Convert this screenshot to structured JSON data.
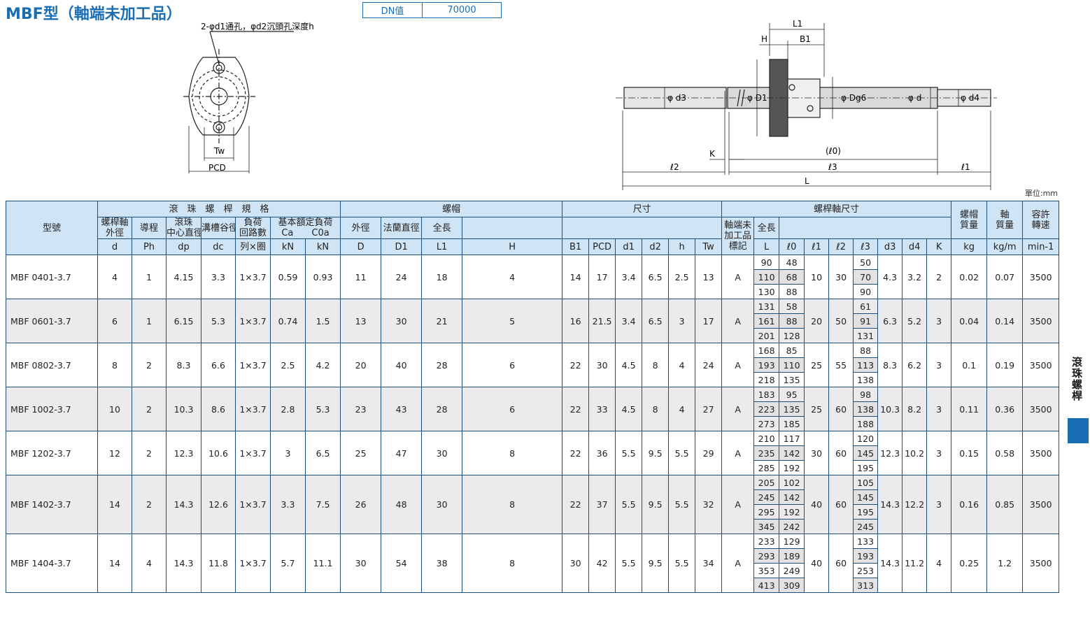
{
  "header": {
    "title": "MBF型（軸端未加工品）",
    "dn_label": "DN值",
    "dn_value": "70000",
    "unit": "單位:mm"
  },
  "drawing": {
    "left_note": "2-φd1通孔，φd2沉頭孔深度h",
    "tw": "Tw",
    "pcd": "PCD",
    "L1": "L1",
    "H": "H",
    "B1": "B1",
    "d3": "φ d3",
    "D1": "φ D1",
    "Dg6": "φ Dg6",
    "d": "φ d",
    "d4": "φ d4",
    "K": "K",
    "l0": "(ℓ0)",
    "l2": "ℓ2",
    "l3": "ℓ3",
    "l1": "ℓ1",
    "L": "L"
  },
  "table_head": {
    "model": "型號",
    "ball_spec": "滾　珠　螺　桿　規　格",
    "nut": "螺帽",
    "nut_dim": "尺寸",
    "shaft_dim": "螺桿軸尺寸",
    "nut_mass_1": "螺帽",
    "nut_mass_2": "質量",
    "shaft_mass_1": "軸",
    "shaft_mass_2": "質量",
    "speed_1": "容許",
    "speed_2": "轉速",
    "od_1": "螺桿軸",
    "od_2": "外徑",
    "lead": "導程",
    "bcd_1": "滾珠",
    "bcd_2": "中心直徑",
    "groove": "溝槽谷徑",
    "circ_1": "負荷",
    "circ_2": "回路數",
    "rating": "基本額定負荷",
    "nut_D": "外徑",
    "flange": "法蘭直徑",
    "nut_len": "全長",
    "shaft_code": "軸端未加工品標記",
    "shaft_len": "全長",
    "ca": "Ca",
    "c0a": "C0a",
    "sym": [
      "d",
      "Ph",
      "dp",
      "dc",
      "列×圈",
      "kN",
      "kN",
      "D",
      "D1",
      "L1",
      "H",
      "B1",
      "PCD",
      "d1",
      "d2",
      "h",
      "Tw",
      "L",
      "ℓ0",
      "ℓ1",
      "ℓ2",
      "ℓ3",
      "d3",
      "d4",
      "K",
      "kg",
      "kg/m",
      "min-1"
    ]
  },
  "rows": [
    {
      "model": "MBF 0401-3.7",
      "d": "4",
      "ph": "1",
      "dp": "4.15",
      "dc": "3.3",
      "circ": "1×3.7",
      "ca": "0.59",
      "c0a": "0.93",
      "D": "11",
      "D1": "24",
      "L1": "18",
      "H": "4",
      "B1": "14",
      "PCD": "17",
      "d1": "3.4",
      "d2": "6.5",
      "h": "2.5",
      "Tw": "13",
      "code": "A",
      "L": [
        "90",
        "110",
        "130"
      ],
      "l0": [
        "48",
        "68",
        "88"
      ],
      "l1": "10",
      "l2": "30",
      "l3": [
        "50",
        "70",
        "90"
      ],
      "d3": "4.3",
      "d4": "3.2",
      "K": "2",
      "nut_mass": "0.02",
      "shaft_mass": "0.07",
      "speed": "3500"
    },
    {
      "model": "MBF 0601-3.7",
      "d": "6",
      "ph": "1",
      "dp": "6.15",
      "dc": "5.3",
      "circ": "1×3.7",
      "ca": "0.74",
      "c0a": "1.5",
      "D": "13",
      "D1": "30",
      "L1": "21",
      "H": "5",
      "B1": "16",
      "PCD": "21.5",
      "d1": "3.4",
      "d2": "6.5",
      "h": "3",
      "Tw": "17",
      "code": "A",
      "L": [
        "131",
        "161",
        "201"
      ],
      "l0": [
        "58",
        "88",
        "128"
      ],
      "l1": "20",
      "l2": "50",
      "l3": [
        "61",
        "91",
        "131"
      ],
      "d3": "6.3",
      "d4": "5.2",
      "K": "3",
      "nut_mass": "0.04",
      "shaft_mass": "0.14",
      "speed": "3500"
    },
    {
      "model": "MBF 0802-3.7",
      "d": "8",
      "ph": "2",
      "dp": "8.3",
      "dc": "6.6",
      "circ": "1×3.7",
      "ca": "2.5",
      "c0a": "4.2",
      "D": "20",
      "D1": "40",
      "L1": "28",
      "H": "6",
      "B1": "22",
      "PCD": "30",
      "d1": "4.5",
      "d2": "8",
      "h": "4",
      "Tw": "24",
      "code": "A",
      "L": [
        "168",
        "193",
        "218"
      ],
      "l0": [
        "85",
        "110",
        "135"
      ],
      "l1": "25",
      "l2": "55",
      "l3": [
        "88",
        "113",
        "138"
      ],
      "d3": "8.3",
      "d4": "6.2",
      "K": "3",
      "nut_mass": "0.1",
      "shaft_mass": "0.19",
      "speed": "3500"
    },
    {
      "model": "MBF 1002-3.7",
      "d": "10",
      "ph": "2",
      "dp": "10.3",
      "dc": "8.6",
      "circ": "1×3.7",
      "ca": "2.8",
      "c0a": "5.3",
      "D": "23",
      "D1": "43",
      "L1": "28",
      "H": "6",
      "B1": "22",
      "PCD": "33",
      "d1": "4.5",
      "d2": "8",
      "h": "4",
      "Tw": "27",
      "code": "A",
      "L": [
        "183",
        "223",
        "273"
      ],
      "l0": [
        "95",
        "135",
        "185"
      ],
      "l1": "25",
      "l2": "60",
      "l3": [
        "98",
        "138",
        "188"
      ],
      "d3": "10.3",
      "d4": "8.2",
      "K": "3",
      "nut_mass": "0.11",
      "shaft_mass": "0.36",
      "speed": "3500"
    },
    {
      "model": "MBF 1202-3.7",
      "d": "12",
      "ph": "2",
      "dp": "12.3",
      "dc": "10.6",
      "circ": "1×3.7",
      "ca": "3",
      "c0a": "6.5",
      "D": "25",
      "D1": "47",
      "L1": "30",
      "H": "8",
      "B1": "22",
      "PCD": "36",
      "d1": "5.5",
      "d2": "9.5",
      "h": "5.5",
      "Tw": "29",
      "code": "A",
      "L": [
        "210",
        "235",
        "285"
      ],
      "l0": [
        "117",
        "142",
        "192"
      ],
      "l1": "30",
      "l2": "60",
      "l3": [
        "120",
        "145",
        "195"
      ],
      "d3": "12.3",
      "d4": "10.2",
      "K": "3",
      "nut_mass": "0.15",
      "shaft_mass": "0.58",
      "speed": "3500"
    },
    {
      "model": "MBF 1402-3.7",
      "d": "14",
      "ph": "2",
      "dp": "14.3",
      "dc": "12.6",
      "circ": "1×3.7",
      "ca": "3.3",
      "c0a": "7.5",
      "D": "26",
      "D1": "48",
      "L1": "30",
      "H": "8",
      "B1": "22",
      "PCD": "37",
      "d1": "5.5",
      "d2": "9.5",
      "h": "5.5",
      "Tw": "32",
      "code": "A",
      "L": [
        "205",
        "245",
        "295",
        "345"
      ],
      "l0": [
        "102",
        "142",
        "192",
        "242"
      ],
      "l1": "40",
      "l2": "60",
      "l3": [
        "105",
        "145",
        "195",
        "245"
      ],
      "d3": "14.3",
      "d4": "12.2",
      "K": "3",
      "nut_mass": "0.16",
      "shaft_mass": "0.85",
      "speed": "3500"
    },
    {
      "model": "MBF 1404-3.7",
      "d": "14",
      "ph": "4",
      "dp": "14.3",
      "dc": "11.8",
      "circ": "1×3.7",
      "ca": "5.7",
      "c0a": "11.1",
      "D": "30",
      "D1": "54",
      "L1": "38",
      "H": "8",
      "B1": "30",
      "PCD": "42",
      "d1": "5.5",
      "d2": "9.5",
      "h": "5.5",
      "Tw": "34",
      "code": "A",
      "L": [
        "233",
        "293",
        "353",
        "413"
      ],
      "l0": [
        "129",
        "189",
        "249",
        "309"
      ],
      "l1": "40",
      "l2": "60",
      "l3": [
        "133",
        "193",
        "253",
        "313"
      ],
      "d3": "14.3",
      "d4": "11.2",
      "K": "4",
      "nut_mass": "0.25",
      "shaft_mass": "1.2",
      "speed": "3500"
    }
  ],
  "side_tab": "滾珠螺桿"
}
